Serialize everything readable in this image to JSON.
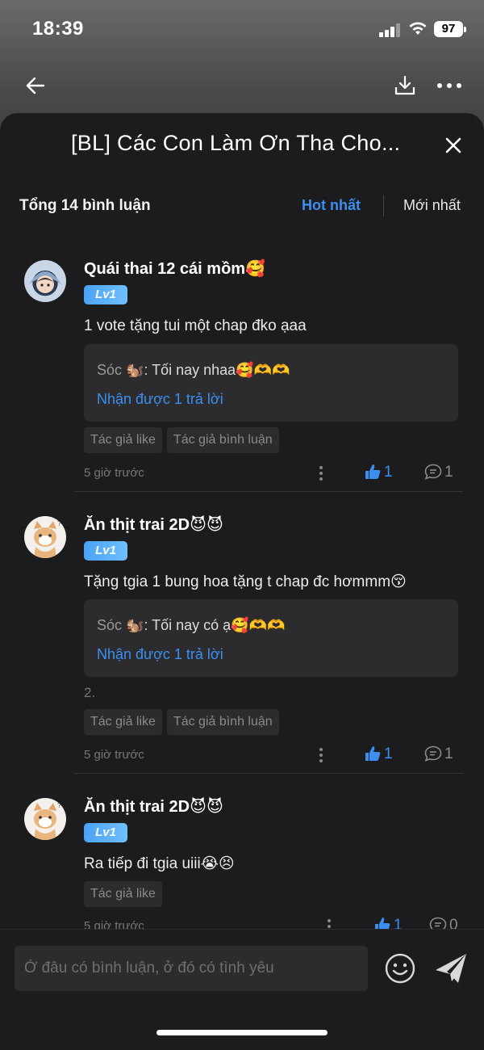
{
  "status": {
    "time": "18:39",
    "battery": "97"
  },
  "sheet": {
    "title": "[BL] Các Con Làm Ơn Tha Cho..."
  },
  "header": {
    "count": "Tổng 14 bình luận",
    "sort_hot": "Hot nhất",
    "sort_new": "Mới nhất"
  },
  "comments": [
    {
      "user": "Quái thai 12 cái mồm🥰",
      "level": "Lv1",
      "text": "1 vote tặng tui một chap đko ạaa",
      "reply_name": "Sóc 🐿️",
      "reply_text": ": Tối nay nhaa🥰🫶🫶",
      "reply_link": "Nhận được 1 trả lời",
      "tags": [
        "Tác giả like",
        "Tác giả bình luận"
      ],
      "time": "5 giờ trước",
      "likes": "1",
      "replies": "1"
    },
    {
      "user": "Ăn thịt trai 2D😈😈",
      "level": "Lv1",
      "text": "Tặng tgia 1 bung hoa tặng t chap đc hơmmm😚",
      "reply_name": "Sóc 🐿️",
      "reply_text": ": Tối nay có ạ🥰🫶🫶",
      "reply_link": "Nhận được 1 trả lời",
      "extra": "2.",
      "tags": [
        "Tác giả like",
        "Tác giả bình luận"
      ],
      "time": "5 giờ trước",
      "likes": "1",
      "replies": "1"
    },
    {
      "user": "Ăn thịt trai 2D😈😈",
      "level": "Lv1",
      "text": "Ra tiếp đi tgia uiii😭😣",
      "tags": [
        "Tác giả like"
      ],
      "time": "5 giờ trước",
      "likes": "1",
      "replies": "0"
    }
  ],
  "input": {
    "placeholder": "Ở đâu có bình luận, ở đó có tình yêu"
  },
  "icons": {
    "back": "arrow-left-icon",
    "download": "download-icon",
    "more": "more-horizontal-icon",
    "close": "close-icon",
    "like": "thumbs-up-icon",
    "reply": "comment-bubble-icon",
    "emoji": "smiley-icon",
    "send": "send-icon"
  },
  "colors": {
    "accent": "#3b8ff0",
    "sheet_bg": "#1c1c1e",
    "card_bg": "#2c2c2e"
  }
}
